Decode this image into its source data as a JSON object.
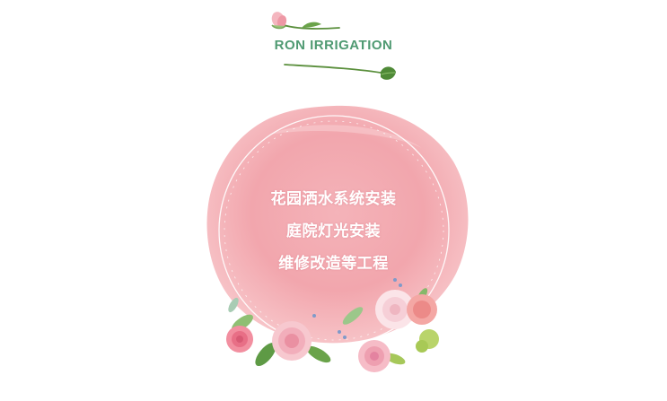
{
  "header": {
    "title": "RON IRRIGATION",
    "title_color": "#4f9a72",
    "top_icon": "rose-bud-icon",
    "bottom_icon": "leaf-icon"
  },
  "badge": {
    "background_color": "#f2a7ad",
    "lines": [
      "花园洒水系统安装",
      "庭院灯光安装",
      "维修改造等工程"
    ],
    "flowers": "rose-bouquet-illustration"
  }
}
